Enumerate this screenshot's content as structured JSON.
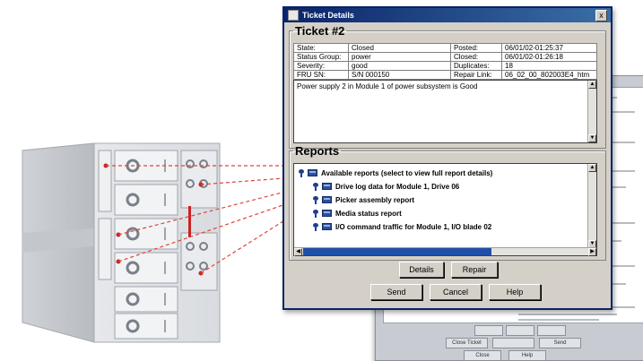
{
  "dialog": {
    "title": "Ticket Details",
    "close_glyph": "x",
    "ticket_heading": "Ticket #2",
    "fields": {
      "state_label": "State:",
      "state_value": "Closed",
      "posted_label": "Posted:",
      "posted_value": "06/01/02-01:25:37",
      "status_group_label": "Status Group:",
      "status_group_value": "power",
      "closed_label": "Closed:",
      "closed_value": "06/01/02-01:26:18",
      "severity_label": "Severity:",
      "severity_value": "good",
      "duplicates_label": "Duplicates:",
      "duplicates_value": "18",
      "fru_sn_label": "FRU SN:",
      "fru_sn_value": "S/N 000150",
      "repair_link_label": "Repair Link:",
      "repair_link_value": "06_02_00_802003E4_htm"
    },
    "description": "Power supply 2 in Module 1 of power subsystem is Good",
    "reports_heading": "Reports",
    "reports": [
      "Available reports (select to view full report details)",
      "Drive log data for Module 1, Drive 06",
      "Picker assembly report",
      "Media status report",
      "I/O command traffic for Module 1, I/O blade 02"
    ],
    "buttons": {
      "details": "Details",
      "repair": "Repair",
      "send": "Send",
      "cancel": "Cancel",
      "help": "Help"
    }
  },
  "background_window": {
    "buttons": [
      "Close Ticket",
      "Send",
      "Close",
      "Help"
    ]
  }
}
